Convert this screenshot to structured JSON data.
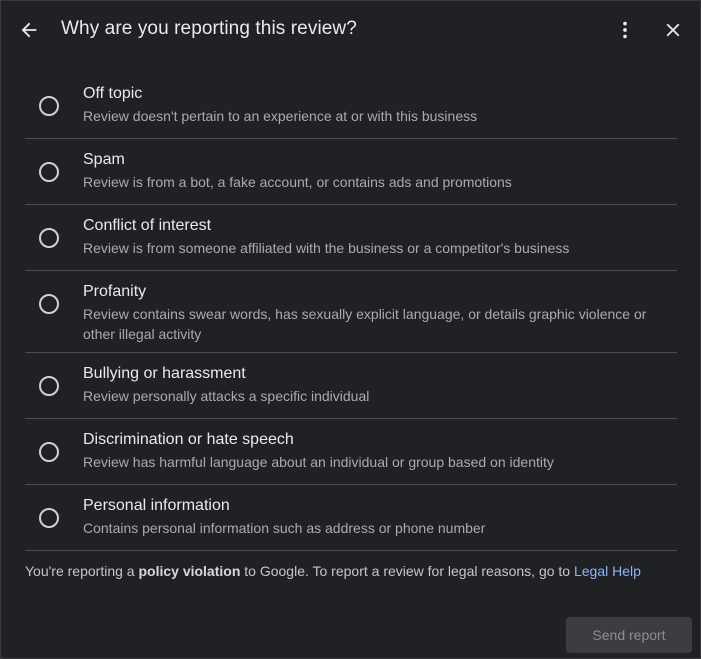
{
  "header": {
    "title": "Why are you reporting this review?",
    "back_icon": "arrow-left-icon",
    "more_icon": "more-vertical-icon",
    "close_icon": "close-icon"
  },
  "options": [
    {
      "label": "Off topic",
      "description": "Review doesn't pertain to an experience at or with this business"
    },
    {
      "label": "Spam",
      "description": "Review is from a bot, a fake account, or contains ads and promotions"
    },
    {
      "label": "Conflict of interest",
      "description": "Review is from someone affiliated with the business or a competitor's business"
    },
    {
      "label": "Profanity",
      "description": "Review contains swear words, has sexually explicit language, or details graphic violence or other illegal activity"
    },
    {
      "label": "Bullying or harassment",
      "description": "Review personally attacks a specific individual"
    },
    {
      "label": "Discrimination or hate speech",
      "description": "Review has harmful language about an individual or group based on identity"
    },
    {
      "label": "Personal information",
      "description": "Contains personal information such as address or phone number"
    }
  ],
  "footer": {
    "text_before": "You're reporting a ",
    "bold_text": "policy violation",
    "text_middle": " to Google. To report a review for legal reasons, go to ",
    "link_text": "Legal Help",
    "send_label": "Send report"
  },
  "colors": {
    "background": "#202124",
    "text": "#e8eaed",
    "secondary_text": "#a9abae",
    "link": "#8ab4f8",
    "disabled_button": "#3c3d40"
  }
}
